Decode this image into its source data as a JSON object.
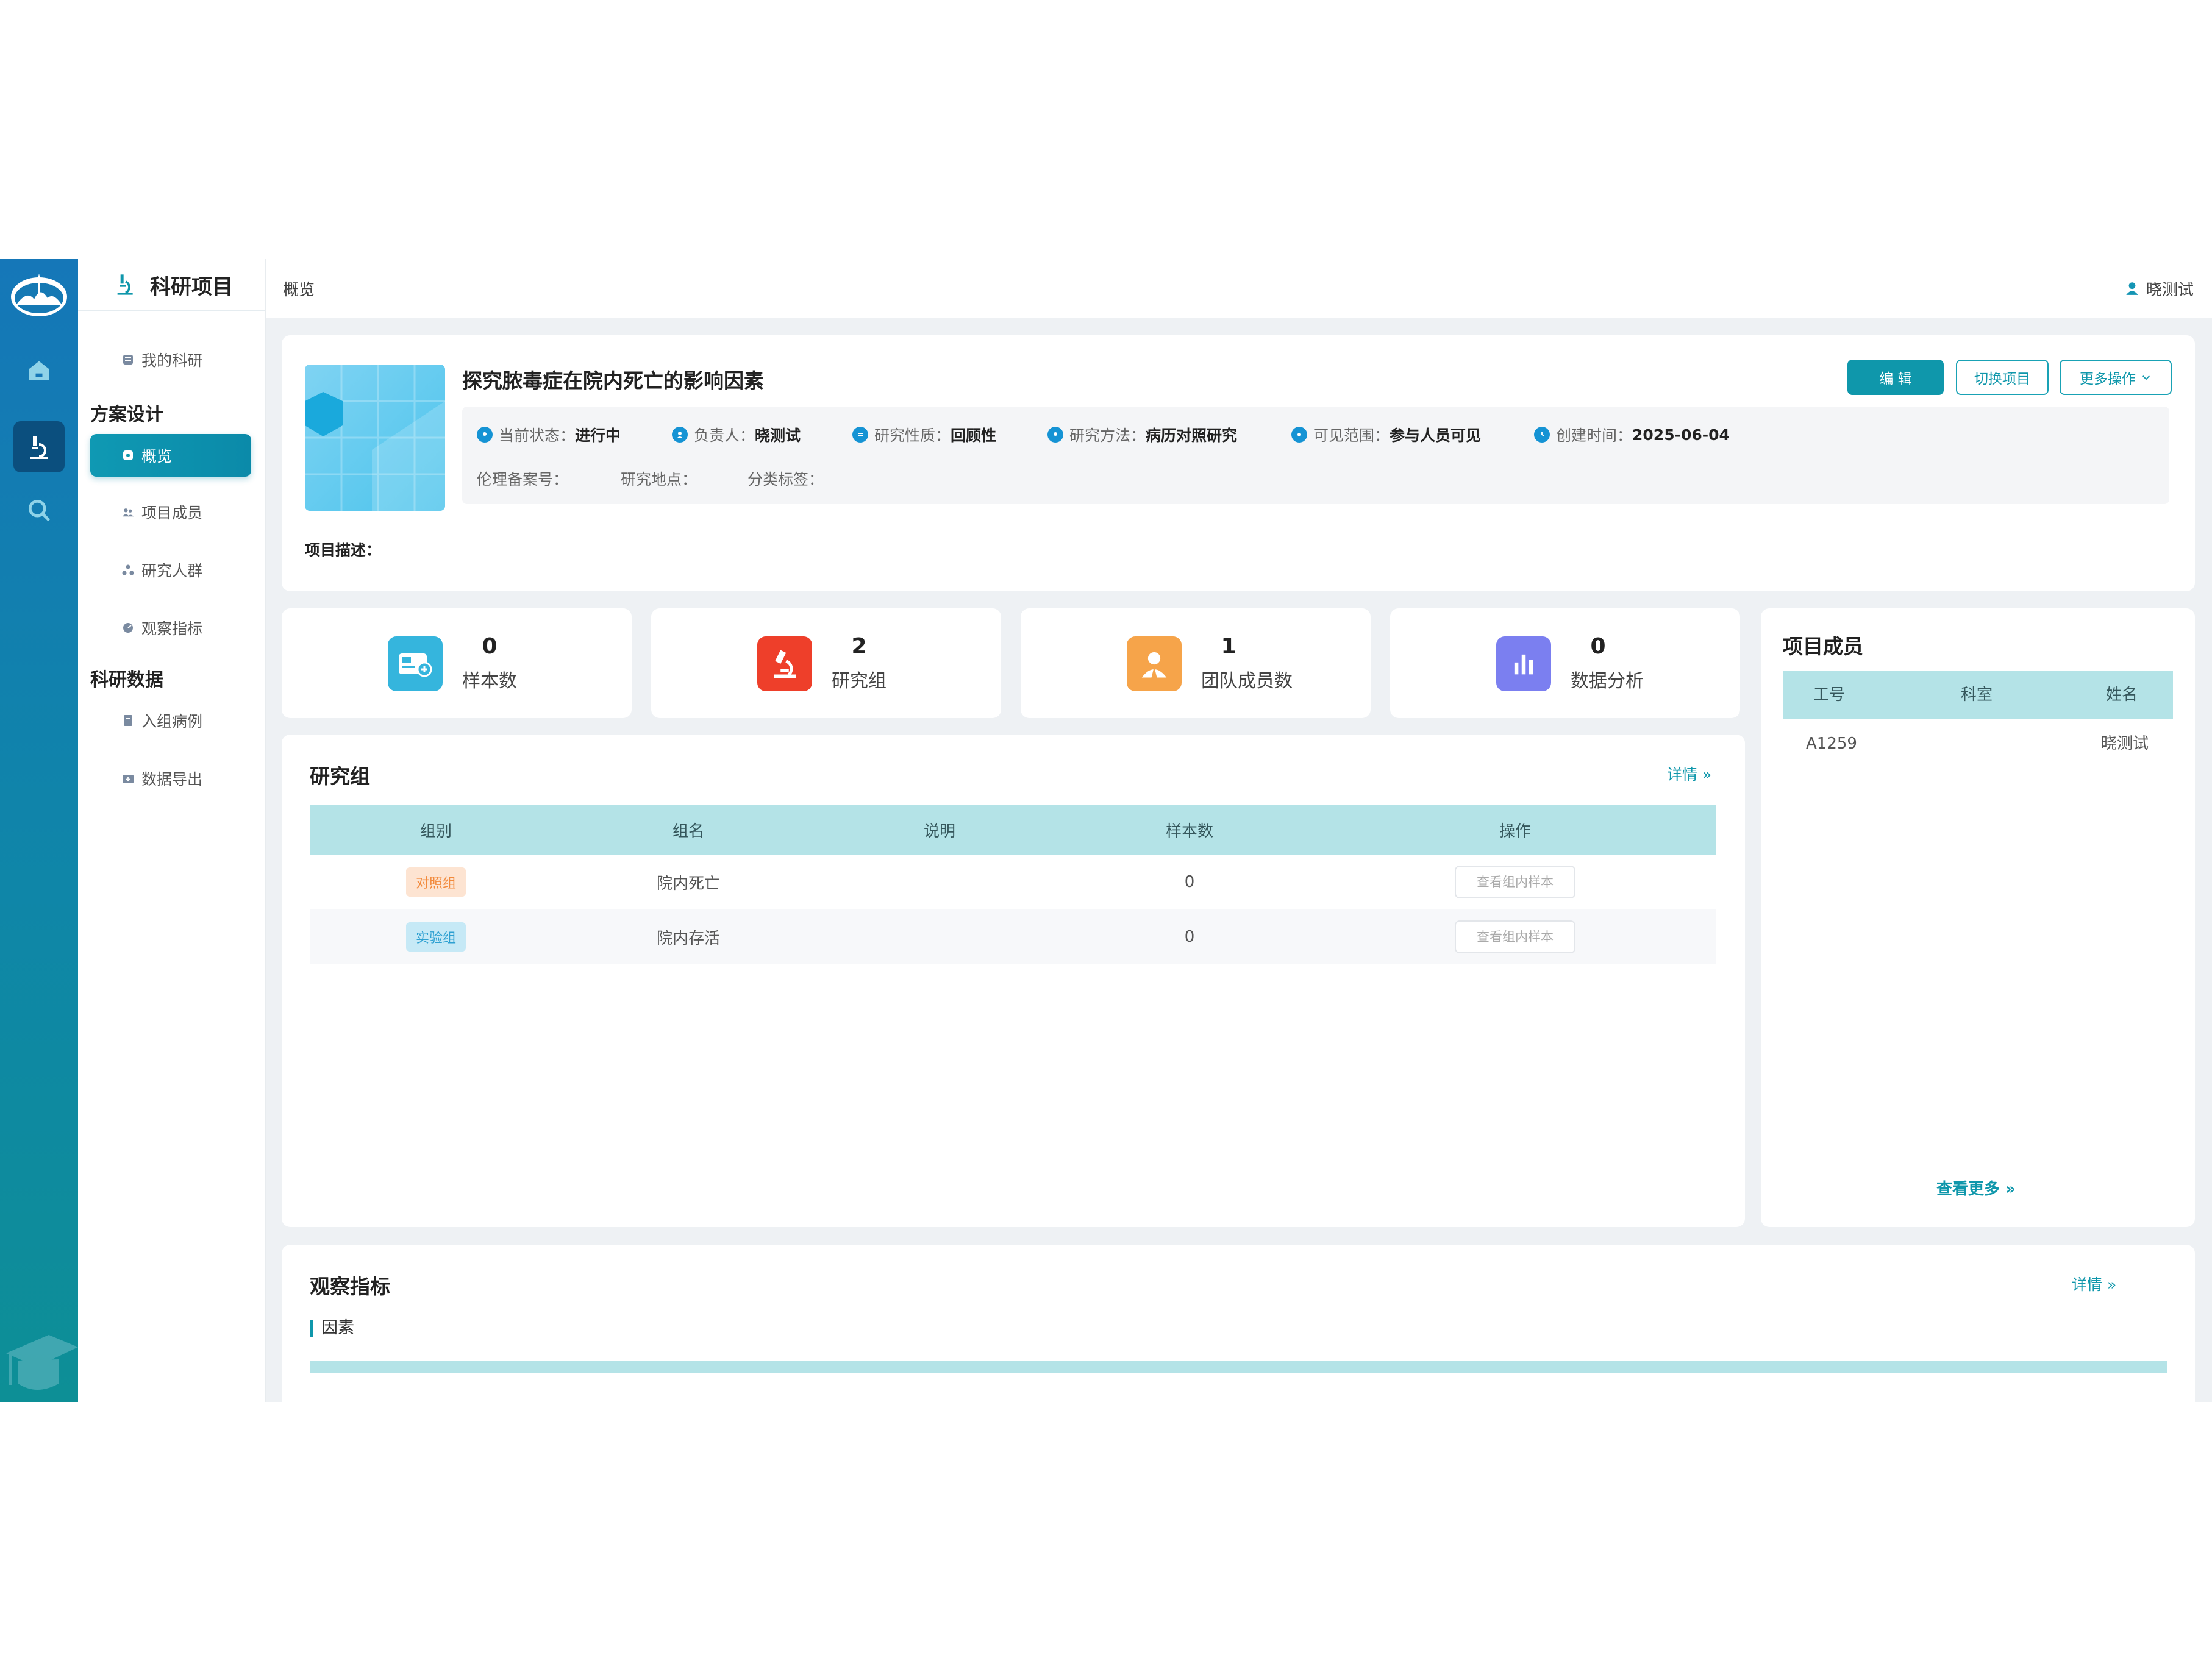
{
  "nav": {
    "module_title": "科研项目",
    "my_research": "我的科研",
    "section_design": "方案设计",
    "overview": "概览",
    "members": "项目成员",
    "population": "研究人群",
    "indicators": "观察指标",
    "section_data": "科研数据",
    "enrolled_cases": "入组病例",
    "data_export": "数据导出"
  },
  "topbar": {
    "breadcrumb": "概览",
    "user": "晓测试"
  },
  "project": {
    "title": "探究脓毒症在院内死亡的影响因素",
    "edit_label": "编 辑",
    "switch_label": "切换项目",
    "more_label": "更多操作",
    "status_label": "当前状态：",
    "status": "进行中",
    "owner_label": "负责人：",
    "owner": "晓测试",
    "nature_label": "研究性质：",
    "nature": "回顾性",
    "method_label": "研究方法：",
    "method": "病历对照研究",
    "visibility_label": "可见范围：",
    "visibility": "参与人员可见",
    "created_label": "创建时间：",
    "created": "2025-06-04",
    "ethics_label": "伦理备案号：",
    "site_label": "研究地点：",
    "tags_label": "分类标签：",
    "desc_label": "项目描述："
  },
  "stats": [
    {
      "value": "0",
      "label": "样本数",
      "color": "#35b5dd"
    },
    {
      "value": "2",
      "label": "研究组",
      "color": "#ee3f2a"
    },
    {
      "value": "1",
      "label": "团队成员数",
      "color": "#f6a44a"
    },
    {
      "value": "0",
      "label": "数据分析",
      "color": "#7b7ff0"
    }
  ],
  "groups": {
    "title": "研究组",
    "detail": "详情",
    "columns": [
      "组别",
      "组名",
      "说明",
      "样本数",
      "操作"
    ],
    "rows": [
      {
        "type": "对照组",
        "name": "院内死亡",
        "desc": "",
        "count": "0",
        "action": "查看组内样本"
      },
      {
        "type": "实验组",
        "name": "院内存活",
        "desc": "",
        "count": "0",
        "action": "查看组内样本"
      }
    ]
  },
  "members": {
    "title": "项目成员",
    "columns": [
      "工号",
      "科室",
      "姓名"
    ],
    "rows": [
      {
        "id": "A1259",
        "dept": "",
        "name": "晓测试"
      }
    ],
    "more": "查看更多"
  },
  "indicators": {
    "title": "观察指标",
    "detail": "详情",
    "sub": "因素"
  }
}
